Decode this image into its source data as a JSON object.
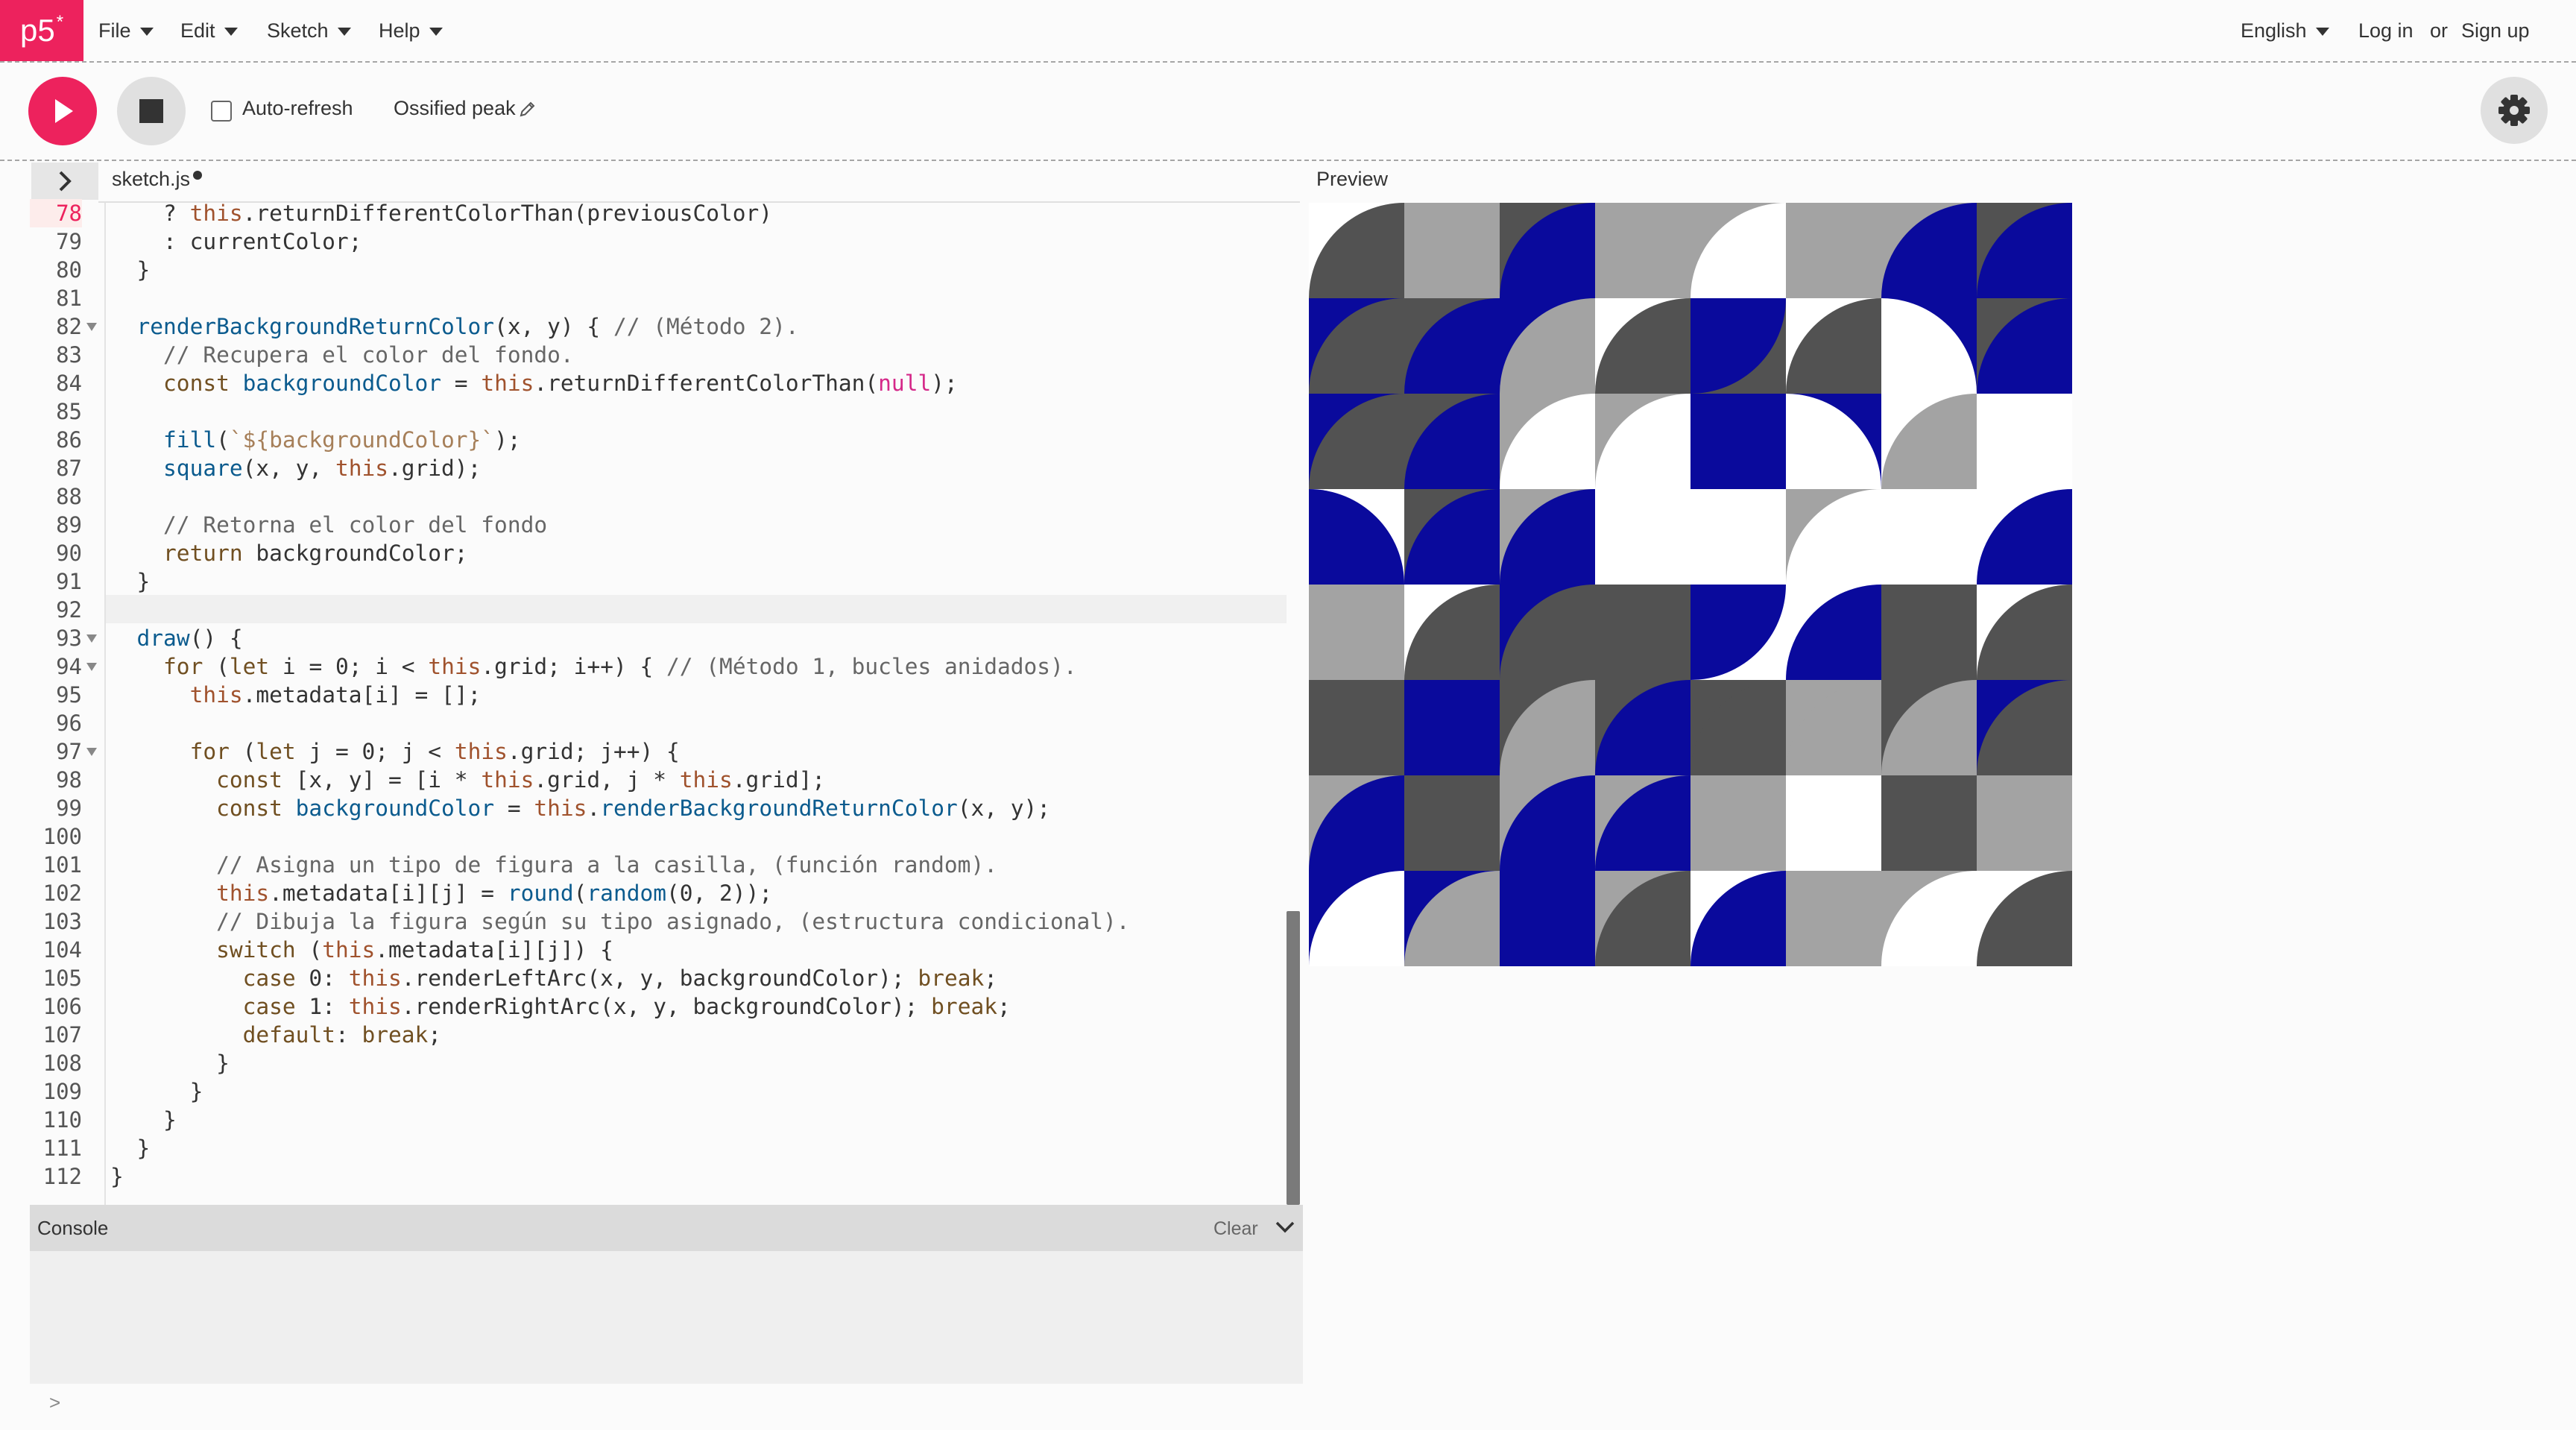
{
  "nav": {
    "logo": "p5",
    "logo_sup": "*",
    "menus": [
      "File",
      "Edit",
      "Sketch",
      "Help"
    ],
    "language": "English",
    "login": "Log in",
    "or": "or",
    "signup": "Sign up"
  },
  "toolbar": {
    "auto_refresh_label": "Auto-refresh",
    "auto_refresh_checked": false,
    "sketch_name": "Ossified peak"
  },
  "editor": {
    "file_name": "sketch.js",
    "unsaved": true,
    "current_line": "92",
    "lines": [
      {
        "n": "78",
        "t": "    ? this.returnDifferentColorThan(previousColor)"
      },
      {
        "n": "79",
        "t": "    : currentColor;"
      },
      {
        "n": "80",
        "t": "  }"
      },
      {
        "n": "81",
        "t": ""
      },
      {
        "n": "82",
        "t": "  renderBackgroundReturnColor(x, y) { // (Método 2).",
        "fold": true
      },
      {
        "n": "83",
        "t": "    // Recupera el color del fondo."
      },
      {
        "n": "84",
        "t": "    const backgroundColor = this.returnDifferentColorThan(null);"
      },
      {
        "n": "85",
        "t": ""
      },
      {
        "n": "86",
        "t": "    fill(`${backgroundColor}`);"
      },
      {
        "n": "87",
        "t": "    square(x, y, this.grid);"
      },
      {
        "n": "88",
        "t": ""
      },
      {
        "n": "89",
        "t": "    // Retorna el color del fondo"
      },
      {
        "n": "90",
        "t": "    return backgroundColor;"
      },
      {
        "n": "91",
        "t": "  }"
      },
      {
        "n": "92",
        "t": ""
      },
      {
        "n": "93",
        "t": "  draw() {",
        "fold": true
      },
      {
        "n": "94",
        "t": "    for (let i = 0; i < this.grid; i++) { // (Método 1, bucles anidados).",
        "fold": true
      },
      {
        "n": "95",
        "t": "      this.metadata[i] = [];"
      },
      {
        "n": "96",
        "t": ""
      },
      {
        "n": "97",
        "t": "      for (let j = 0; j < this.grid; j++) {",
        "fold": true
      },
      {
        "n": "98",
        "t": "        const [x, y] = [i * this.grid, j * this.grid];"
      },
      {
        "n": "99",
        "t": "        const backgroundColor = this.renderBackgroundReturnColor(x, y);"
      },
      {
        "n": "100",
        "t": ""
      },
      {
        "n": "101",
        "t": "        // Asigna un tipo de figura a la casilla, (función random)."
      },
      {
        "n": "102",
        "t": "        this.metadata[i][j] = round(random(0, 2));"
      },
      {
        "n": "103",
        "t": "        // Dibuja la figura según su tipo asignado, (estructura condicional)."
      },
      {
        "n": "104",
        "t": "        switch (this.metadata[i][j]) {"
      },
      {
        "n": "105",
        "t": "          case 0: this.renderLeftArc(x, y, backgroundColor); break;"
      },
      {
        "n": "106",
        "t": "          case 1: this.renderRightArc(x, y, backgroundColor); break;"
      },
      {
        "n": "107",
        "t": "          default: break;"
      },
      {
        "n": "108",
        "t": "        }"
      },
      {
        "n": "109",
        "t": "      }"
      },
      {
        "n": "110",
        "t": "    }"
      },
      {
        "n": "111",
        "t": "  }"
      },
      {
        "n": "112",
        "t": "}"
      }
    ]
  },
  "console": {
    "title": "Console",
    "clear_label": "Clear",
    "prompt": ">"
  },
  "preview": {
    "label": "Preview",
    "palette": {
      "W": "#ffffff",
      "L": "#a3a3a3",
      "D": "#525252",
      "B": "#0a0a9c"
    },
    "cells": [
      [
        [
          "W",
          "D",
          "BR"
        ],
        [
          "L",
          "L",
          ""
        ],
        [
          "D",
          "B",
          "BR"
        ],
        [
          "L",
          "L",
          ""
        ],
        [
          "L",
          "W",
          "BR"
        ],
        [
          "L",
          "L",
          ""
        ],
        [
          "L",
          "B",
          "BR"
        ],
        [
          "D",
          "B",
          "BR"
        ]
      ],
      [
        [
          "B",
          "D",
          "BR"
        ],
        [
          "D",
          "B",
          "BR"
        ],
        [
          "B",
          "L",
          "BR"
        ],
        [
          "W",
          "D",
          "BR"
        ],
        [
          "D",
          "B",
          "TL"
        ],
        [
          "W",
          "D",
          "BR"
        ],
        [
          "B",
          "W",
          "BL"
        ],
        [
          "D",
          "B",
          "BR"
        ]
      ],
      [
        [
          "B",
          "D",
          "BR"
        ],
        [
          "D",
          "B",
          "BR"
        ],
        [
          "L",
          "W",
          "BR"
        ],
        [
          "L",
          "W",
          "BR"
        ],
        [
          "B",
          "B",
          ""
        ],
        [
          "B",
          "W",
          "BL"
        ],
        [
          "W",
          "L",
          "BR"
        ],
        [
          "W",
          "W",
          ""
        ]
      ],
      [
        [
          "W",
          "B",
          "BL"
        ],
        [
          "D",
          "B",
          "BR"
        ],
        [
          "L",
          "B",
          "BR"
        ],
        [
          "W",
          "W",
          ""
        ],
        [
          "W",
          "W",
          ""
        ],
        [
          "L",
          "W",
          "BR"
        ],
        [
          "W",
          "W",
          ""
        ],
        [
          "W",
          "B",
          "BR"
        ]
      ],
      [
        [
          "L",
          "L",
          ""
        ],
        [
          "W",
          "D",
          "BR"
        ],
        [
          "B",
          "D",
          "BR"
        ],
        [
          "D",
          "D",
          ""
        ],
        [
          "W",
          "B",
          "TL"
        ],
        [
          "W",
          "B",
          "BR"
        ],
        [
          "D",
          "D",
          ""
        ],
        [
          "W",
          "D",
          "BR"
        ]
      ],
      [
        [
          "D",
          "D",
          ""
        ],
        [
          "B",
          "B",
          ""
        ],
        [
          "D",
          "L",
          "BR"
        ],
        [
          "D",
          "B",
          "BR"
        ],
        [
          "D",
          "D",
          "BR"
        ],
        [
          "L",
          "L",
          "BR"
        ],
        [
          "D",
          "L",
          "BR"
        ],
        [
          "B",
          "D",
          "BR"
        ]
      ],
      [
        [
          "L",
          "B",
          "BR"
        ],
        [
          "D",
          "D",
          ""
        ],
        [
          "L",
          "B",
          "BR"
        ],
        [
          "L",
          "B",
          "BR"
        ],
        [
          "L",
          "L",
          ""
        ],
        [
          "W",
          "W",
          ""
        ],
        [
          "D",
          "D",
          ""
        ],
        [
          "L",
          "L",
          ""
        ]
      ],
      [
        [
          "B",
          "W",
          "BR"
        ],
        [
          "B",
          "L",
          "BR"
        ],
        [
          "B",
          "B",
          ""
        ],
        [
          "L",
          "D",
          "BR"
        ],
        [
          "W",
          "B",
          "BR"
        ],
        [
          "L",
          "L",
          ""
        ],
        [
          "L",
          "W",
          "BR"
        ],
        [
          "W",
          "D",
          "BR"
        ]
      ]
    ]
  }
}
